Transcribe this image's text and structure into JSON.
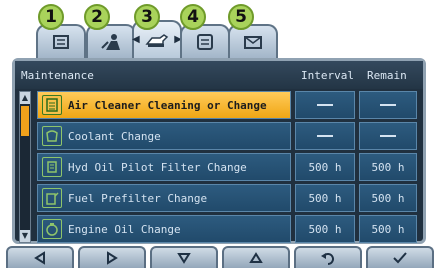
{
  "tabs": [
    {
      "number": "1",
      "icon": "book-icon"
    },
    {
      "number": "2",
      "icon": "wrench-person-icon"
    },
    {
      "number": "3",
      "icon": "machine-icon",
      "active": true,
      "arrow_left": "◀",
      "arrow_right": "▶"
    },
    {
      "number": "4",
      "icon": "list-icon"
    },
    {
      "number": "5",
      "icon": "envelope-icon"
    }
  ],
  "header": {
    "title": "Maintenance",
    "interval": "Interval",
    "remain": "Remain"
  },
  "rows": [
    {
      "label": "Air Cleaner Cleaning or Change",
      "icon": "air-filter-icon",
      "interval": "—",
      "remain": "—",
      "selected": true
    },
    {
      "label": "Coolant Change",
      "icon": "coolant-icon",
      "interval": "—",
      "remain": "—"
    },
    {
      "label": "Hyd Oil Pilot Filter Change",
      "icon": "hydraulic-filter-icon",
      "interval": "500 h",
      "remain": "500 h"
    },
    {
      "label": "Fuel Prefilter Change",
      "icon": "fuel-filter-icon",
      "interval": "500 h",
      "remain": "500 h"
    },
    {
      "label": "Engine Oil Change",
      "icon": "engine-oil-icon",
      "interval": "500 h",
      "remain": "500 h"
    }
  ],
  "nav": [
    "left-arrow-icon",
    "right-arrow-icon",
    "down-arrow-icon",
    "up-arrow-icon",
    "back-icon",
    "check-icon"
  ],
  "colors": {
    "accent_selected": "#f0a614",
    "badge": "#a9d35b",
    "panel": "#20303f",
    "row": "#2d5b7f"
  }
}
